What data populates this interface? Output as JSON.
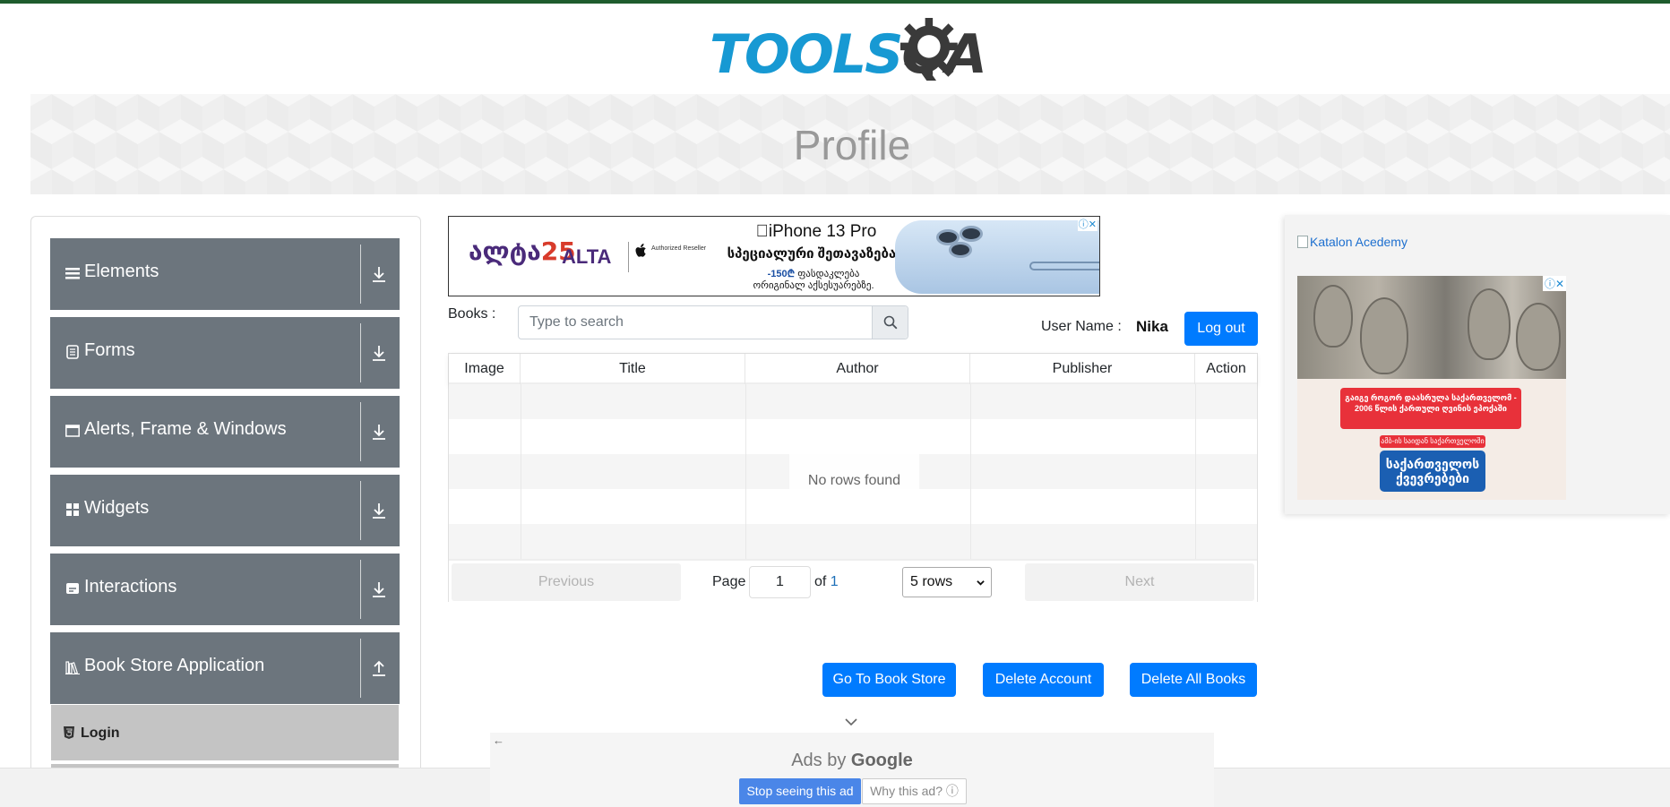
{
  "logo": {
    "part1": "TOOLS",
    "part2": "QA"
  },
  "banner": {
    "title": "Profile"
  },
  "sidebar": {
    "groups": [
      {
        "label": "Elements",
        "icon": "hamburger-icon",
        "expanded": false
      },
      {
        "label": "Forms",
        "icon": "document-icon",
        "expanded": false
      },
      {
        "label": "Alerts, Frame & Windows",
        "icon": "window-icon",
        "expanded": false
      },
      {
        "label": "Widgets",
        "icon": "grid-icon",
        "expanded": false
      },
      {
        "label": "Interactions",
        "icon": "cursor-icon",
        "expanded": false
      },
      {
        "label": "Book Store Application",
        "icon": "books-icon",
        "expanded": true
      }
    ],
    "sub_items": [
      {
        "label": "Login",
        "icon": "html5-icon"
      }
    ]
  },
  "top_ad": {
    "brand_prefix": "ალტა",
    "brand_num": "25",
    "brand_name": "ALTA",
    "authorized": "Authorized Reseller",
    "product": "iPhone 13 Pro",
    "promo": "სპეციალური შეთავაზება.",
    "price": "-150₾",
    "promo_line2": "ფასდაკლება",
    "promo_line3": "ორიგინალ აქსესუარებზე.",
    "adchoices": "ⓘ✕"
  },
  "books_toolbar": {
    "books_label": "Books :",
    "search_placeholder": "Type to search",
    "user_label": "User Name :",
    "user_value": "Nika",
    "logout_label": "Log out"
  },
  "table": {
    "columns": [
      "Image",
      "Title",
      "Author",
      "Publisher",
      "Action"
    ],
    "empty_message": "No rows found",
    "pager": {
      "previous": "Previous",
      "page_label": "Page",
      "page_value": "1",
      "of_label": "of",
      "total_pages": "1",
      "rows_option": "5 rows",
      "next": "Next"
    }
  },
  "actions": {
    "go_to_store": "Go To Book Store",
    "delete_account": "Delete Account",
    "delete_all_books": "Delete All Books"
  },
  "right_ad": {
    "katalon_alt": "Katalon Acedemy",
    "red_text": "გაიგე როგორ დაასრულა საქართველომ - 2006 წლის ქართული ღვინის ეპოქაში",
    "small_red": "ამბ-ის საიდან საქართველოში",
    "blue_text": "საქართველოს ქვევრებები",
    "adchoices": "ⓘ✕"
  },
  "bottom_ad": {
    "ads_by": "Ads by",
    "google": "Google",
    "stop_label": "Stop seeing this ad",
    "why_label": "Why this ad? ⓘ"
  },
  "colors": {
    "brand_blue": "#1799d3",
    "primary": "#007bff",
    "sidebar_group": "#6c757d",
    "sidebar_sub": "#c4c4c4"
  }
}
